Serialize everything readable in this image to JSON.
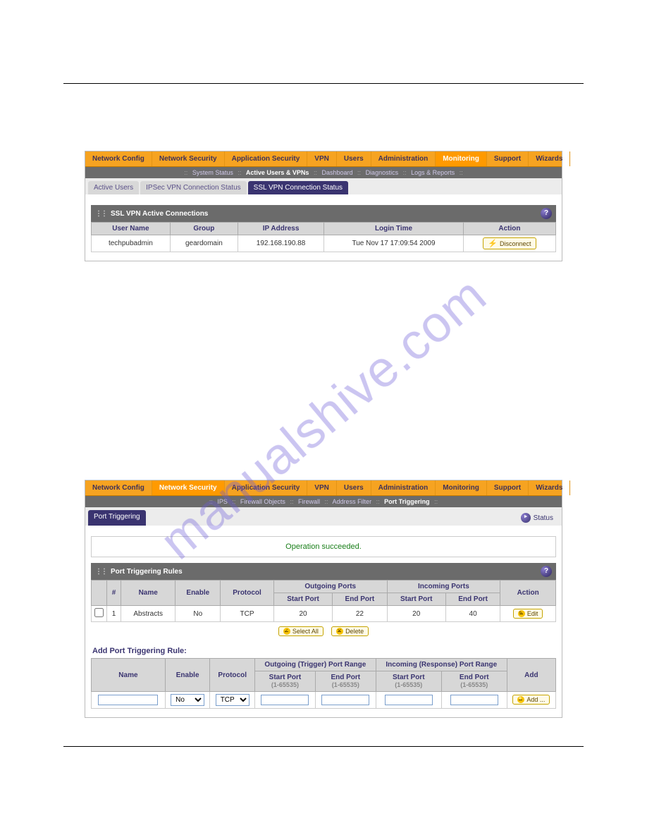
{
  "watermark": "manualshive.com",
  "main_nav": [
    {
      "label": "Network Config",
      "id": "network-config"
    },
    {
      "label": "Network Security",
      "id": "network-security"
    },
    {
      "label": "Application Security",
      "id": "application-security"
    },
    {
      "label": "VPN",
      "id": "vpn"
    },
    {
      "label": "Users",
      "id": "users"
    },
    {
      "label": "Administration",
      "id": "administration"
    },
    {
      "label": "Monitoring",
      "id": "monitoring"
    },
    {
      "label": "Support",
      "id": "support"
    },
    {
      "label": "Wizards",
      "id": "wizards"
    }
  ],
  "panel1": {
    "active_nav": "Monitoring",
    "subnav": {
      "sep": "::",
      "items": [
        "System Status",
        "Active Users & VPNs",
        "Dashboard",
        "Diagnostics",
        "Logs & Reports"
      ],
      "active": "Active Users & VPNs"
    },
    "tabs": [
      {
        "label": "Active Users",
        "active": false
      },
      {
        "label": "IPSec VPN Connection Status",
        "active": false
      },
      {
        "label": "SSL VPN Connection Status",
        "active": true
      }
    ],
    "section_title": "SSL VPN Active Connections",
    "columns": [
      "User Name",
      "Group",
      "IP Address",
      "Login Time",
      "Action"
    ],
    "row": {
      "user": "techpubadmin",
      "group": "geardomain",
      "ip": "192.168.190.88",
      "login": "Tue Nov 17 17:09:54 2009",
      "action": "Disconnect"
    }
  },
  "panel2": {
    "active_nav": "Network Security",
    "subnav": {
      "sep": "::",
      "items": [
        "IPS",
        "Firewall Objects",
        "Firewall",
        "Address Filter",
        "Port Triggering"
      ],
      "active": "Port Triggering"
    },
    "tab": "Port Triggering",
    "status_label": "Status",
    "success": "Operation succeeded.",
    "section_title": "Port Triggering Rules",
    "columns": {
      "checkbox": "",
      "num": "#",
      "name": "Name",
      "enable": "Enable",
      "protocol": "Protocol",
      "outgoing": "Outgoing Ports",
      "incoming": "Incoming Ports",
      "action": "Action",
      "start": "Start Port",
      "end": "End Port"
    },
    "row": {
      "num": "1",
      "name": "Abstracts",
      "enable": "No",
      "protocol": "TCP",
      "out_start": "20",
      "out_end": "22",
      "in_start": "20",
      "in_end": "40",
      "action": "Edit"
    },
    "buttons": {
      "select_all": "Select All",
      "delete": "Delete"
    },
    "form": {
      "title": "Add Port Triggering Rule:",
      "headers": {
        "name": "Name",
        "enable": "Enable",
        "protocol": "Protocol",
        "out_range": "Outgoing (Trigger) Port Range",
        "in_range": "Incoming (Response) Port Range",
        "add": "Add",
        "start": "Start Port",
        "end": "End Port",
        "hint": "(1-65535)"
      },
      "defaults": {
        "enable": "No",
        "protocol": "TCP",
        "add": "Add ..."
      }
    }
  }
}
